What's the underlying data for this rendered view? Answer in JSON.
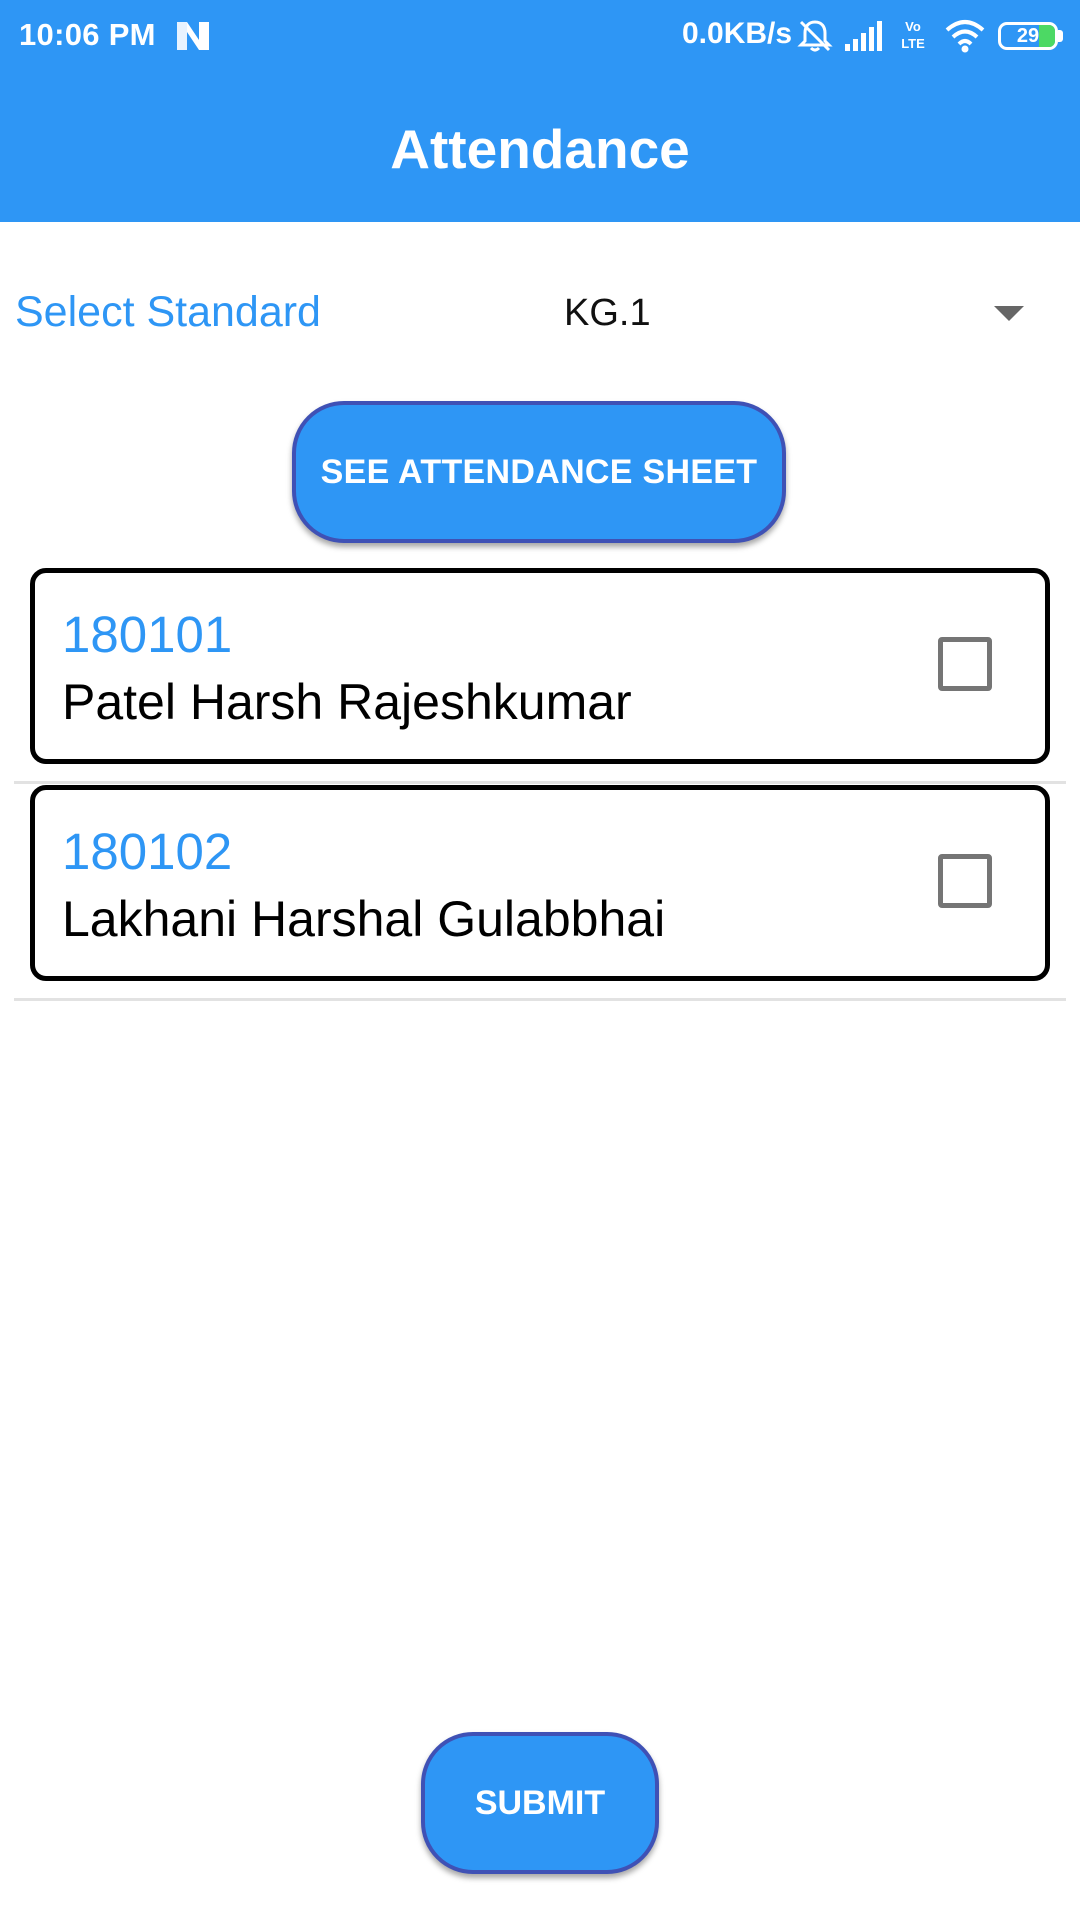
{
  "status_bar": {
    "time": "10:06 PM",
    "network_speed": "0.0KB/s",
    "volte": "Vo LTE",
    "battery_level": "29",
    "battery_fraction": 0.29,
    "icons": [
      "notification-n-icon",
      "bell-muted-icon",
      "cell-signal-icon",
      "volte-icon",
      "wifi-icon",
      "battery-icon"
    ]
  },
  "header": {
    "title": "Attendance"
  },
  "standard_selector": {
    "label": "Select Standard",
    "selected_value": "KG.1"
  },
  "see_sheet_button_label": "SEE ATTENDANCE SHEET",
  "students": [
    {
      "id": "180101",
      "name": "Patel Harsh Rajeshkumar",
      "checked": false
    },
    {
      "id": "180102",
      "name": "Lakhani Harshal Gulabbhai",
      "checked": false
    }
  ],
  "submit_label": "SUBMIT",
  "colors": {
    "primary": "#2e96f5",
    "button_border": "#3f51b5",
    "card_border": "#000000",
    "battery_fill": "#4cd964"
  }
}
